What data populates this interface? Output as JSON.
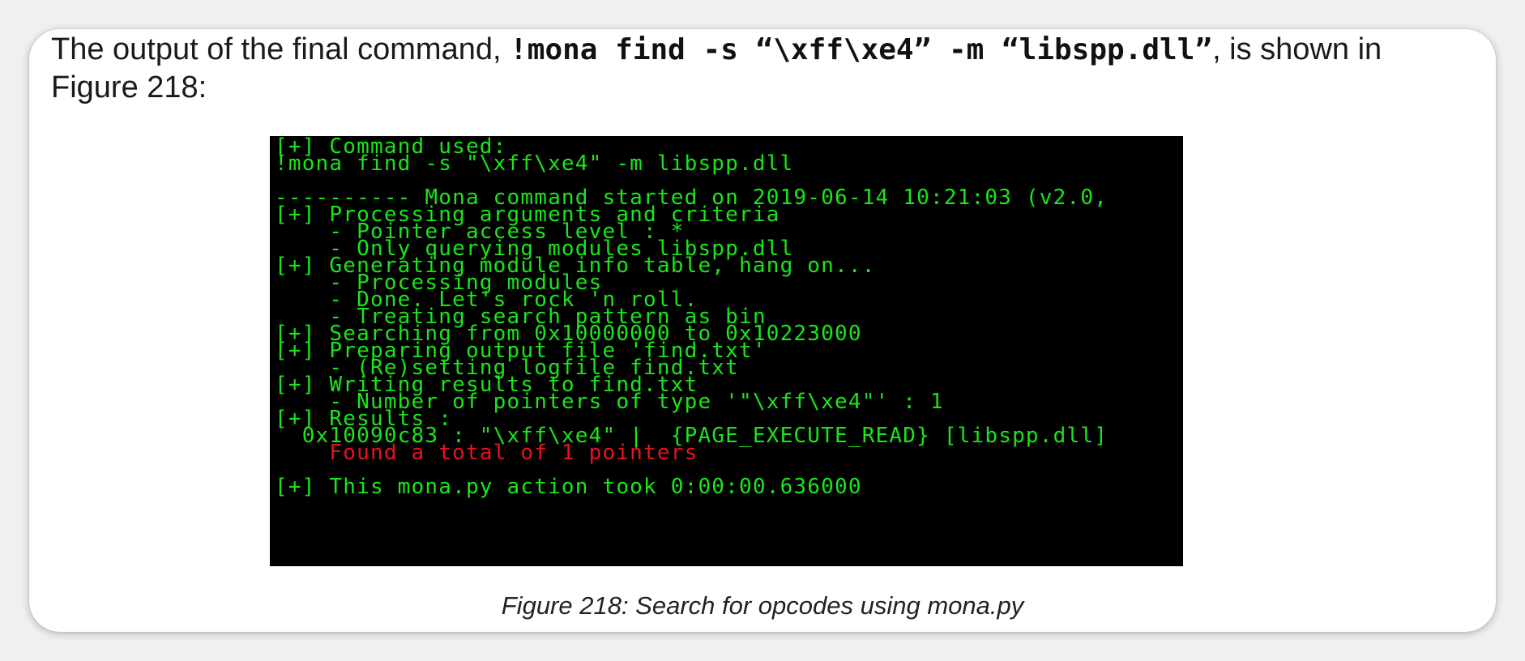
{
  "intro": {
    "before": "The output of the final command, ",
    "command": "!mona find -s “\\xff\\xe4” -m “libspp.dll”",
    "after": ", is shown in Figure 218:"
  },
  "terminal": {
    "lines": [
      "[+] Command used:",
      "!mona find -s \"\\xff\\xe4\" -m libspp.dll",
      "",
      "---------- Mona command started on 2019-06-14 10:21:03 (v2.0,",
      "[+] Processing arguments and criteria",
      "    - Pointer access level : *",
      "    - Only querying modules libspp.dll",
      "[+] Generating module info table, hang on...",
      "    - Processing modules",
      "    - Done. Let's rock 'n roll.",
      "    - Treating search pattern as bin",
      "[+] Searching from 0x10000000 to 0x10223000",
      "[+] Preparing output file 'find.txt'",
      "    - (Re)setting logfile find.txt",
      "[+] Writing results to find.txt",
      "    - Number of pointers of type '\"\\xff\\xe4\"' : 1",
      "[+] Results :",
      "  0x10090c83 : \"\\xff\\xe4\" |  {PAGE_EXECUTE_READ} [libspp.dll]",
      "    Found a total of 1 pointers",
      "",
      "[+] This mona.py action took 0:00:00.636000"
    ],
    "colors": {
      "background": "#000000",
      "text": "#19e619",
      "highlight": "#e8141a"
    }
  },
  "caption": "Figure 218: Search for opcodes using mona.py"
}
